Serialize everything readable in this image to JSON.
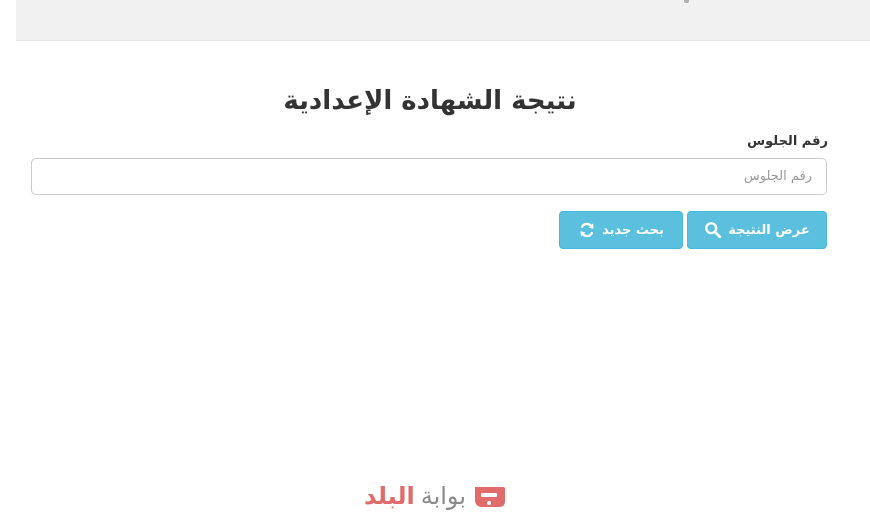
{
  "header": {
    "title": "نتيجة الشهادة الإعدادية"
  },
  "form": {
    "seat_label": "رقم الجلوس",
    "seat_placeholder": "رقم الجلوس",
    "seat_value": ""
  },
  "buttons": {
    "show_result_label": "عرض النتيجة",
    "new_search_label": "بحث جديد"
  },
  "brand": {
    "word1": "بوابة",
    "word2": "البلد"
  },
  "colors": {
    "button_bg": "#5bc0de",
    "button_border": "#46b8da",
    "brand_accent": "#e06b6b",
    "brand_gray": "#8a8a8a",
    "top_bar_bg": "#f1f1f1"
  },
  "icons": {
    "show_result": "search-icon",
    "new_search": "refresh-icon",
    "brand": "brand-logo-icon"
  }
}
